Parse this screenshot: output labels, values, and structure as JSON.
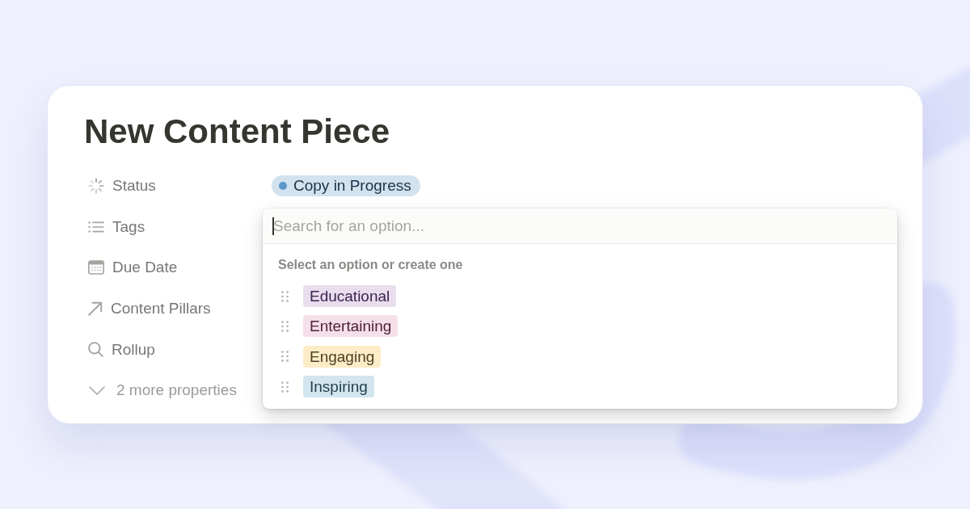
{
  "page": {
    "title": "New Content Piece",
    "properties": [
      {
        "kind": "status",
        "label": "Status",
        "value": {
          "label": "Copy in Progress",
          "color": "#5b97c9"
        }
      },
      {
        "kind": "multi_select",
        "label": "Tags"
      },
      {
        "kind": "date",
        "label": "Due Date"
      },
      {
        "kind": "relation",
        "label": "Content Pillars"
      },
      {
        "kind": "rollup",
        "label": "Rollup"
      }
    ],
    "more_properties": {
      "label": "2 more properties",
      "expanded": false
    }
  },
  "dropdown": {
    "search": {
      "placeholder": "Search for an option...",
      "focused": true
    },
    "hint": "Select an option or create one",
    "options": [
      {
        "label": "Educational",
        "color": "#e8deee"
      },
      {
        "label": "Entertaining",
        "color": "#f5e0e9"
      },
      {
        "label": "Engaging",
        "color": "#fdecc8"
      },
      {
        "label": "Inspiring",
        "color": "#d3e5ef"
      }
    ]
  }
}
